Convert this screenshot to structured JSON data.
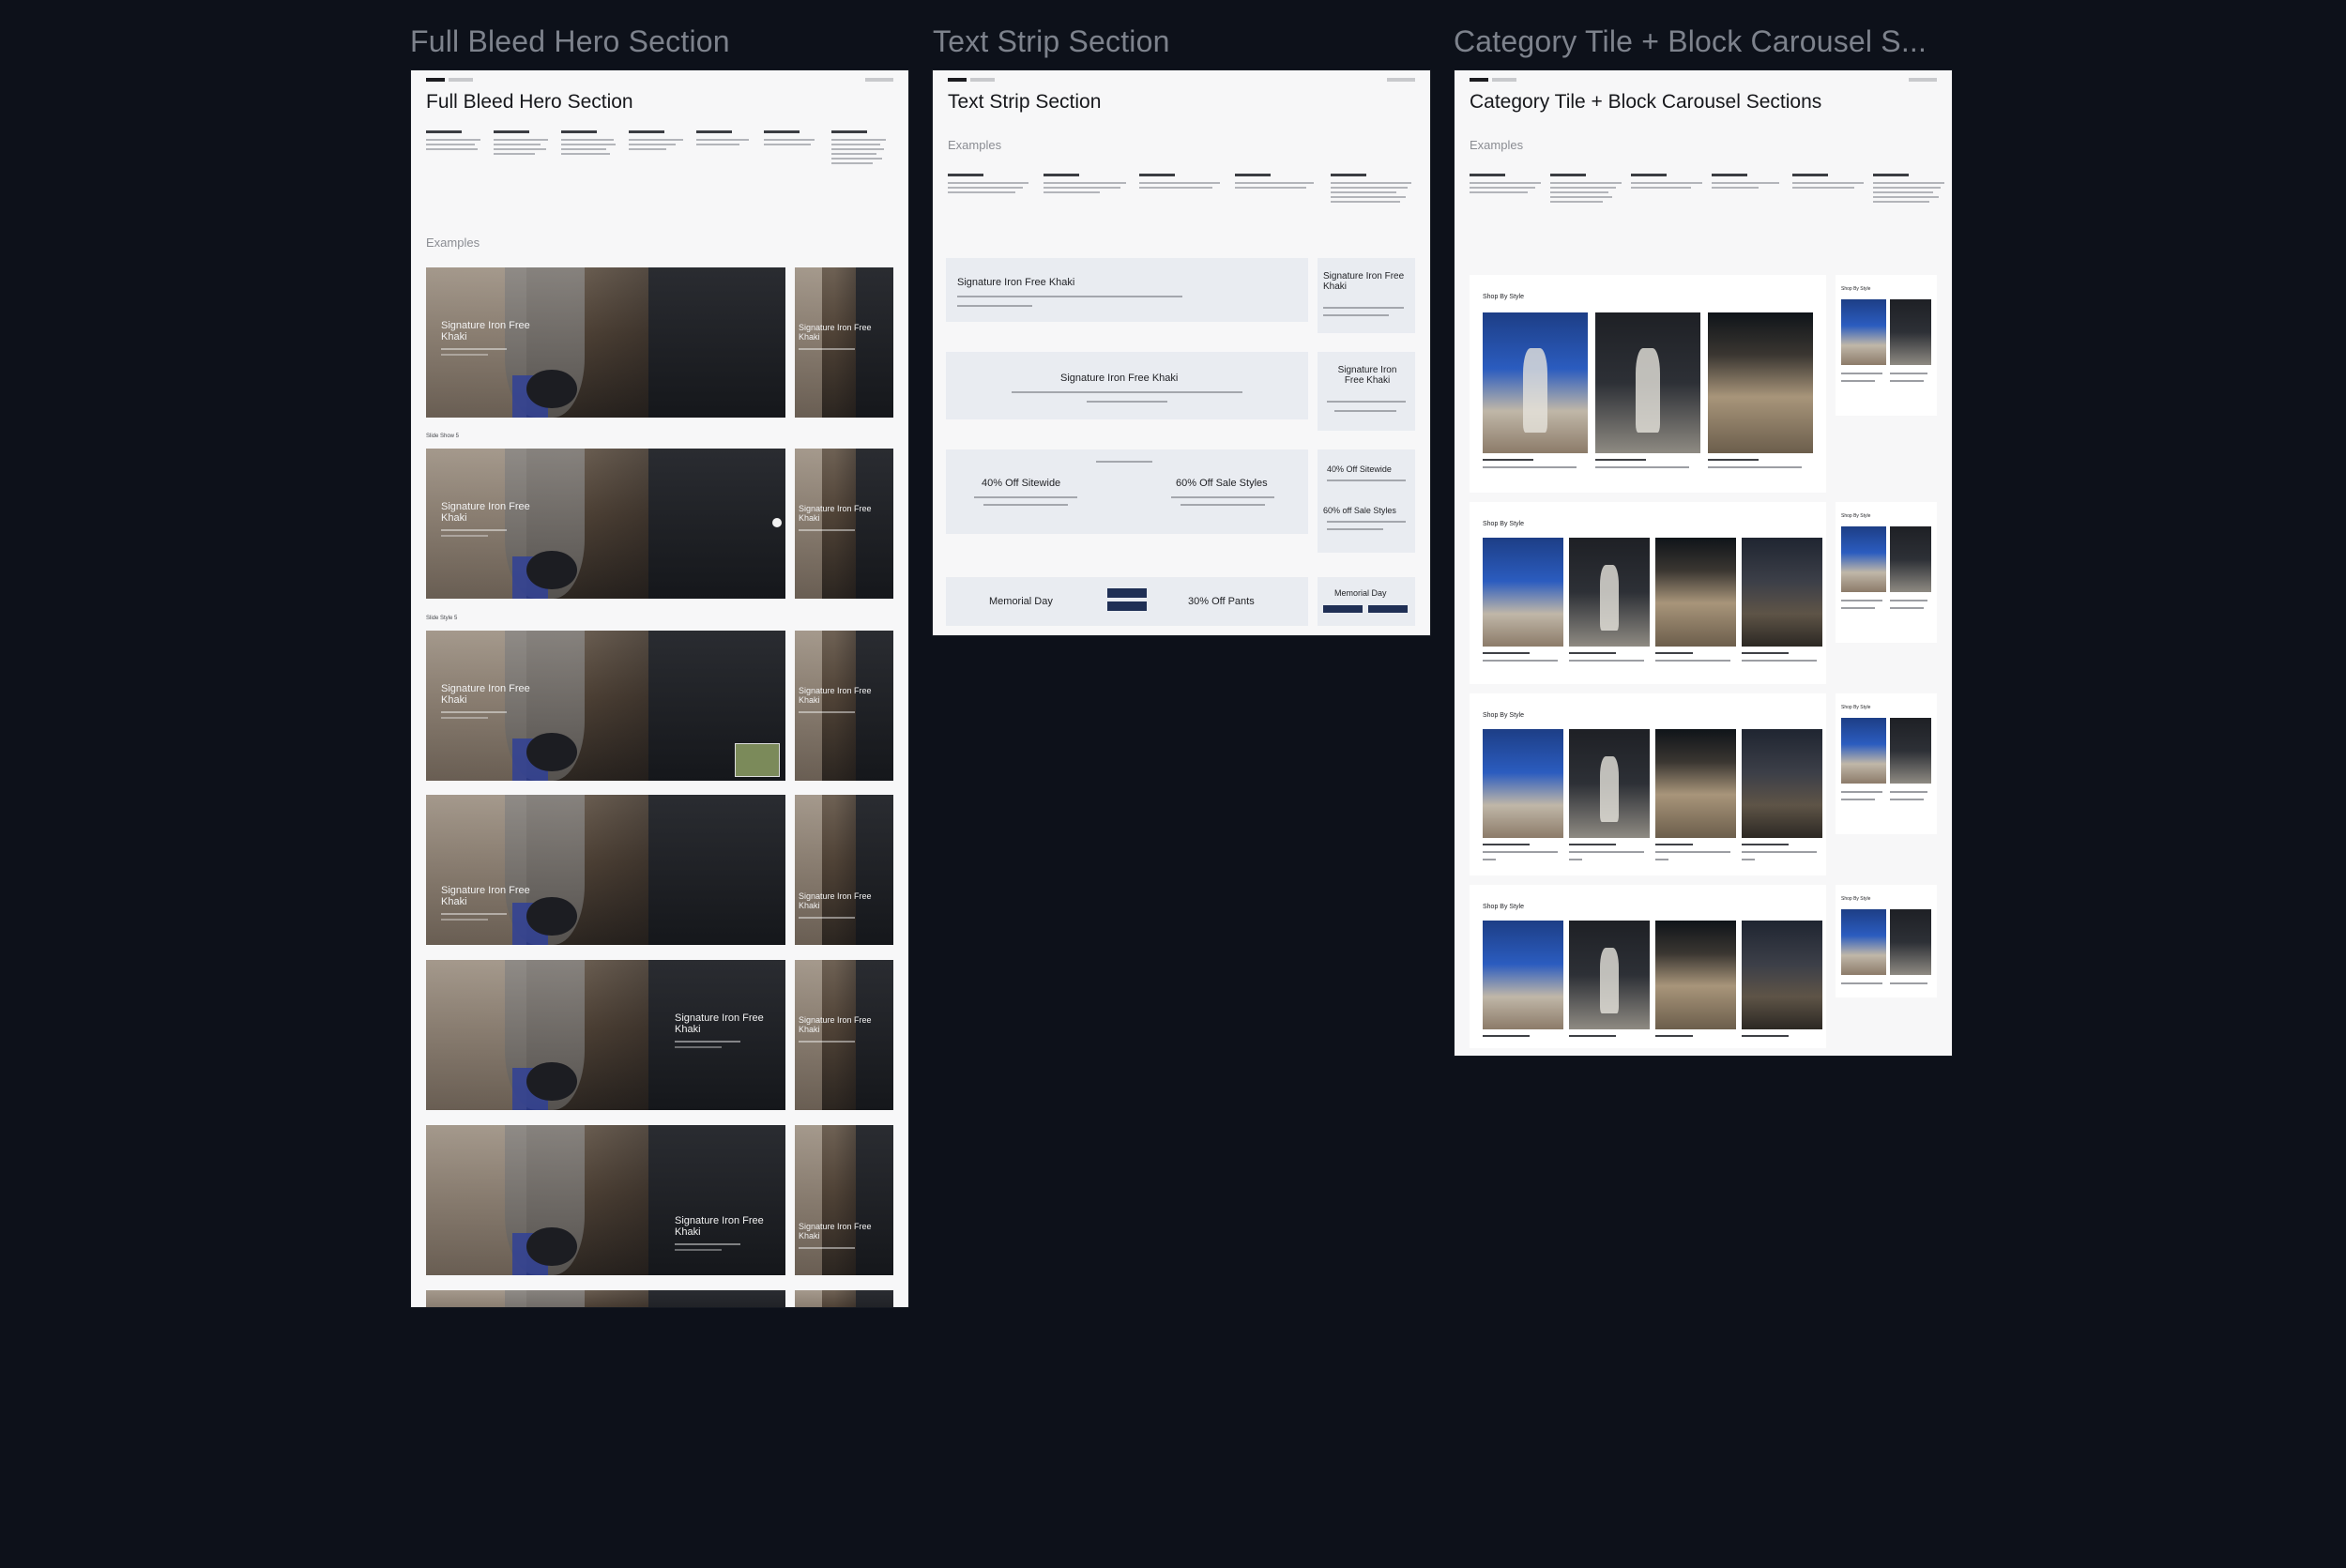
{
  "canvas": {
    "background": "#0d111a",
    "frames": [
      {
        "label": "Full Bleed Hero Section",
        "title": "Full Bleed Hero Section",
        "examples_label": "Examples",
        "row_labels": [
          "Slide Show 5",
          "Slide Style 5"
        ],
        "hero_text": "Signature Iron Free Khaki"
      },
      {
        "label": "Text Strip Section",
        "title": "Text Strip Section",
        "examples_label": "Examples",
        "strips": {
          "headline": "Signature Iron Free Khaki",
          "narrow_headline": "Signature Iron Free Khaki",
          "promo_left": "40% Off Sitewide",
          "promo_right": "60% Off Sale Styles",
          "narrow_promo_left": "40% Off Sitewide",
          "narrow_promo_right": "60% off Sale Styles",
          "footer_left": "Memorial Day",
          "footer_right": "30% Off Pants",
          "narrow_footer": "Memorial Day"
        }
      },
      {
        "label": "Category Tile + Block Carousel S...",
        "title": "Category Tile + Block Carousel Sections",
        "examples_label": "Examples",
        "section_title": "Shop By Style"
      }
    ]
  },
  "colors": {
    "frame_bg": "#f7f7f8",
    "label": "#7d828c",
    "accent_navy": "#1f2f55"
  }
}
